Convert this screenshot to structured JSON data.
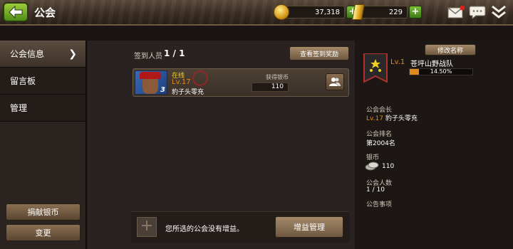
{
  "header": {
    "title": "公会",
    "coins": "37,318",
    "gold": "229",
    "coin_plus": "+",
    "gold_plus": "+"
  },
  "sidebar": {
    "items": [
      {
        "label": "公会信息",
        "active": true
      },
      {
        "label": "留言板",
        "active": false
      },
      {
        "label": "管理",
        "active": false
      }
    ],
    "donate_label": "捐献银币",
    "change_label": "变更"
  },
  "main": {
    "checkin_label": "签到人员",
    "checkin_count": "1 / 1",
    "view_reward_label": "查看签到奖励",
    "member": {
      "status": "在线",
      "level": "Lv.17",
      "name": "豹子头零充",
      "avatar_level": "3",
      "silver_label": "获得银币",
      "silver_value": "110"
    },
    "bonus_slot_symbol": "+",
    "bonus_text": "您所选的公会没有增益。",
    "bonus_manage_label": "增益管理"
  },
  "guild": {
    "rename_label": "修改名称",
    "level": "Lv.1",
    "name": "苍坪山野战队",
    "exp_percent_text": "14.50%",
    "exp_fraction": 0.145,
    "leader_label": "公会会长",
    "leader_level": "Lv.17",
    "leader_name": "豹子头零充",
    "rank_label": "公会排名",
    "rank_value": "第2004名",
    "silver_label": "银币",
    "silver_value": "110",
    "members_label": "公会人数",
    "members_value": "1 / 10",
    "notice_label": "公告事项"
  },
  "colors": {
    "accent_orange": "#e08a1a",
    "online_yellow": "#f0d020",
    "green_button": "#5a9a1e"
  },
  "icons": [
    "back-arrow-icon",
    "coin-icon",
    "gold-bar-icon",
    "mail-icon",
    "chat-icon",
    "collapse-chevrons-icon",
    "chevron-right-icon",
    "member-manage-icon",
    "guild-emblem-icon",
    "silver-coins-icon"
  ]
}
